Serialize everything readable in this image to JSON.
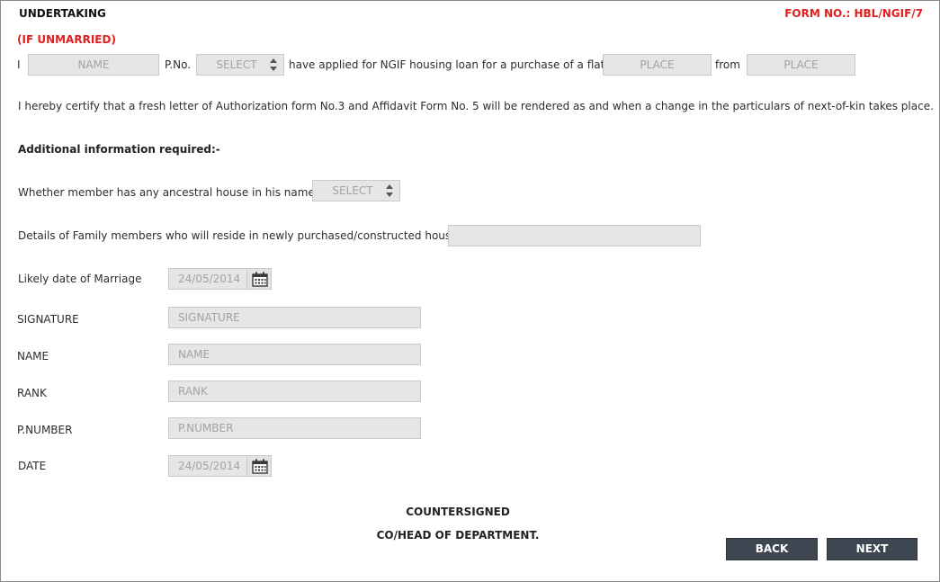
{
  "header": {
    "title": "UNDERTAKING",
    "form_no": "FORM NO.: HBL/NGIF/7",
    "subtitle": "(IF UNMARRIED)"
  },
  "declaration": {
    "prefix": "I",
    "name_placeholder": "NAME",
    "pno_label": "P.No.",
    "pno_select": "SELECT",
    "middle_text": "have applied for NGIF housing loan for a purchase of a flat at",
    "place1_placeholder": "PLACE",
    "from_label": "from",
    "place2_placeholder": "PLACE"
  },
  "certify_text": "I hereby certify that a fresh letter of Authorization form No.3 and Affidavit Form No. 5 will be rendered as and when a change in the particulars of next-of-kin takes place.",
  "additional": {
    "heading": "Additional information required:-",
    "ancestral_label": "Whether member has any ancestral house in his name",
    "ancestral_select": "SELECT",
    "family_label": "Details of Family members who will reside in newly purchased/constructed house",
    "family_value": "",
    "marriage_label": "Likely date of Marriage",
    "marriage_date": "24/05/2014"
  },
  "fields": {
    "signature_label": "SIGNATURE",
    "signature_placeholder": "SIGNATURE",
    "name_label": "NAME",
    "name_placeholder": "NAME",
    "rank_label": "RANK",
    "rank_placeholder": "RANK",
    "pnumber_label": "P.NUMBER",
    "pnumber_placeholder": "P.NUMBER",
    "date_label": "DATE",
    "date_value": "24/05/2014"
  },
  "footer": {
    "countersigned": "COUNTERSIGNED",
    "head": "CO/HEAD OF DEPARTMENT.",
    "back_label": "BACK",
    "next_label": "NEXT"
  },
  "colors": {
    "accent_red": "#e02020",
    "button_bg": "#3e4652",
    "field_bg": "#e6e6e6"
  }
}
